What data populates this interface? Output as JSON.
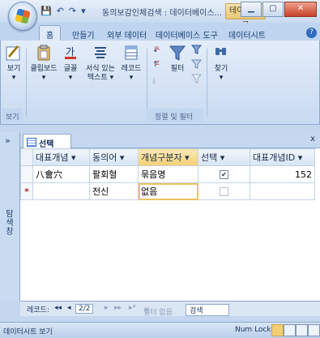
{
  "window": {
    "title": "동의보감인체검색 : 데이터베이스...",
    "context_tab": "테이블 도구",
    "buttons": [
      "minimize",
      "maximize",
      "close"
    ]
  },
  "qat": {
    "save_icon": "save-icon",
    "undo_icon": "undo-icon",
    "redo_icon": "redo-icon"
  },
  "tabs": [
    "홈",
    "만들기",
    "외부 데이터",
    "데이터베이스 도구",
    "데이터시트"
  ],
  "ribbon": {
    "items": [
      {
        "label1": "보기",
        "label2": "▾",
        "icon": "view-icon"
      },
      {
        "label1": "클립보드",
        "label2": "▾",
        "icon": "clipboard-icon"
      },
      {
        "label1": "글꼴",
        "label2": "▾",
        "icon": "font-icon"
      },
      {
        "label1": "서식 있는",
        "label2": "텍스트 ▾",
        "icon": "richtext-icon"
      },
      {
        "label1": "레코드",
        "label2": "▾",
        "icon": "records-icon"
      },
      {
        "label1": "필터",
        "label2": "",
        "icon": "filter-icon"
      },
      {
        "label1": "찾기",
        "label2": "▾",
        "icon": "find-icon"
      }
    ],
    "groups": {
      "views": "보기",
      "sort_filter": "정렬 및 필터"
    }
  },
  "nav_pane": {
    "chevron": "»",
    "label": "탐색 창"
  },
  "doc_tab": {
    "label": "선택",
    "close": "x"
  },
  "table": {
    "columns": [
      "대표개념 ▾",
      "동의어 ▾",
      "개념구분자 ▾",
      "선택 ▾",
      "대표개념ID ▾"
    ],
    "rows": [
      {
        "marker": "",
        "c1": "八會穴",
        "c2": "팔회혈",
        "c3": "묶음명",
        "checked": true,
        "c5": "152"
      },
      {
        "marker": "*",
        "c1": "",
        "c2": "전신",
        "c3": "없음",
        "checked": false,
        "c5": ""
      }
    ]
  },
  "record_nav": {
    "label": "레코드:",
    "first": "◂◂",
    "prev": "◂",
    "current": "2/2",
    "next": "▸",
    "last": "▸▸",
    "new": "▸*",
    "filter": "필터 없음",
    "search": "검색"
  },
  "status": {
    "left": "데이터시트 보기",
    "numlock": "Num Lock"
  }
}
